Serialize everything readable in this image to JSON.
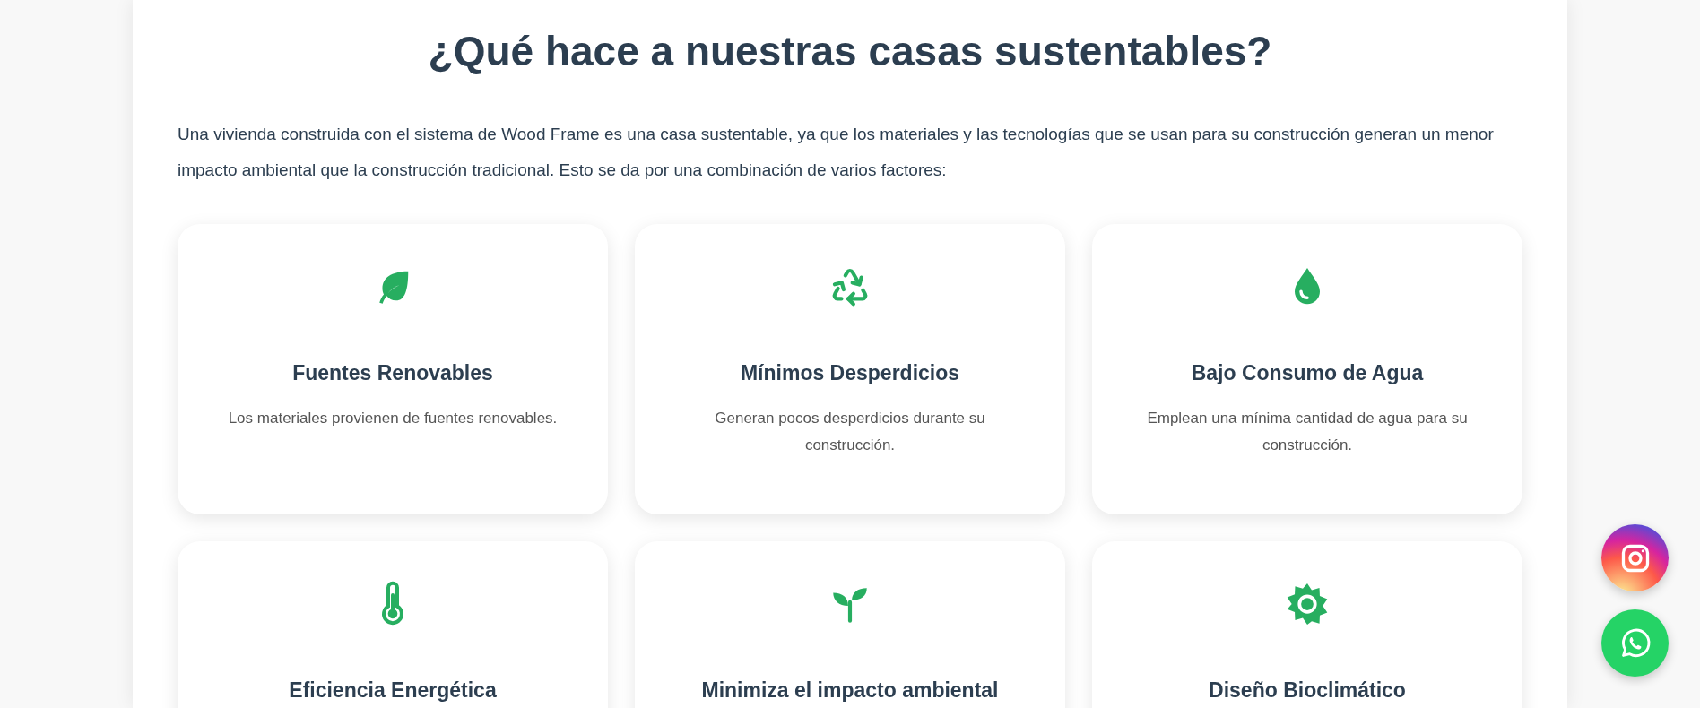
{
  "section": {
    "heading": "¿Qué hace a nuestras casas sustentables?",
    "intro": "Una vivienda construida con el sistema de Wood Frame es una casa sustentable, ya que los materiales y las tecnologías que se usan para su construcción generan un menor impacto ambiental que la construcción tradicional. Esto se da por una combinación de varios factores:",
    "features": [
      {
        "kind": "leaf",
        "title": "Fuentes Renovables",
        "description": "Los materiales provienen de fuentes renovables."
      },
      {
        "kind": "recycle",
        "title": "Mínimos Desperdicios",
        "description": "Generan pocos desperdicios durante su construcción."
      },
      {
        "kind": "drop",
        "title": "Bajo Consumo de Agua",
        "description": "Emplean una mínima cantidad de agua para su construcción."
      },
      {
        "kind": "thermometer",
        "title": "Eficiencia Energética"
      },
      {
        "kind": "seedling",
        "title": "Minimiza el impacto ambiental"
      },
      {
        "kind": "sun",
        "title": "Diseño Bioclimático"
      }
    ]
  },
  "floating_buttons": [
    {
      "kind": "instagram"
    },
    {
      "kind": "whatsapp"
    }
  ]
}
